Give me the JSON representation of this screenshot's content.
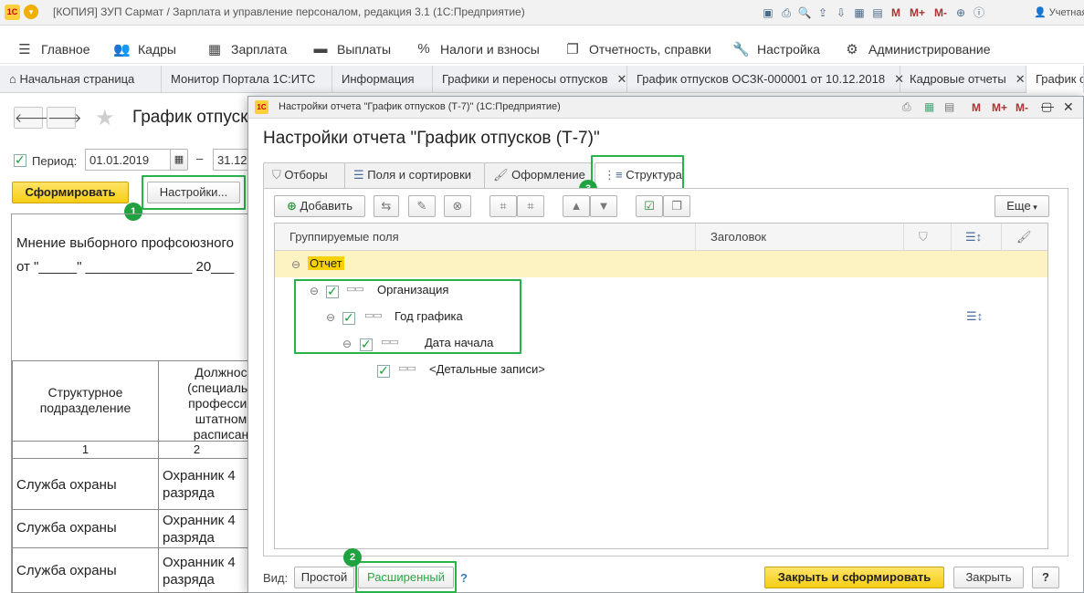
{
  "app": {
    "title": "[КОПИЯ] ЗУП Сармат / Зарплата и управление персоналом, редакция 3.1  (1С:Предприятие)",
    "logo": "1С",
    "user": "Учетная",
    "titlebar_icons": [
      "save-icon",
      "print-icon",
      "preview-icon",
      "upload-icon",
      "download-icon",
      "calculator-icon",
      "calendar-icon"
    ],
    "titlebar_m": [
      "M",
      "M+",
      "M-"
    ]
  },
  "main_menu": [
    {
      "label": "Главное",
      "icon": "menu-icon"
    },
    {
      "label": "Кадры",
      "icon": "people-icon"
    },
    {
      "label": "Зарплата",
      "icon": "calculator-icon"
    },
    {
      "label": "Выплаты",
      "icon": "wallet-icon"
    },
    {
      "label": "Налоги и взносы",
      "icon": "percent-icon"
    },
    {
      "label": "Отчетность, справки",
      "icon": "documents-icon"
    },
    {
      "label": "Настройка",
      "icon": "wrench-icon"
    },
    {
      "label": "Администрирование",
      "icon": "gear-icon"
    }
  ],
  "window_tabs": [
    {
      "label": "Начальная страница"
    },
    {
      "label": "Монитор Портала 1С:ИТС"
    },
    {
      "label": "Информация"
    },
    {
      "label": "Графики и переносы отпусков"
    },
    {
      "label": "График отпусков ОСЗК-000001 от 10.12.2018"
    },
    {
      "label": "Кадровые отчеты"
    },
    {
      "label": "График о"
    }
  ],
  "background": {
    "title": "График отпусков",
    "period_label": "Период:",
    "period_from": "01.01.2019",
    "period_dash": "–",
    "period_to": "31.12",
    "generate_button": "Сформировать",
    "settings_button": "Настройки...",
    "doc_line1": "Мнение выборного профсоюзного",
    "doc_line2": "от \"_____\" ______________ 20___",
    "table_headers": [
      "Структурное подразделение",
      "Должнос (специальн профессия штатном расписан"
    ],
    "column_numbers": [
      "1",
      "2"
    ],
    "rows": [
      {
        "dept": "Служба охраны",
        "position": "Охранник 4 разряда"
      },
      {
        "dept": "Служба охраны",
        "position": "Охранник 4 разряда"
      },
      {
        "dept": "Служба охраны",
        "position": "Охранник 4 разряда"
      }
    ]
  },
  "modal": {
    "window_title": "Настройки отчета \"График отпусков (Т-7)\"  (1С:Предприятие)",
    "heading": "Настройки отчета \"График отпусков (Т-7)\"",
    "tabs": [
      {
        "label": "Отборы",
        "icon": "filter-icon"
      },
      {
        "label": "Поля и сортировки",
        "icon": "sort-icon"
      },
      {
        "label": "Оформление",
        "icon": "brush-icon"
      },
      {
        "label": "Структура",
        "icon": "structure-icon"
      }
    ],
    "toolbar": {
      "add_label": "Добавить",
      "more_label": "Еще"
    },
    "grid": {
      "col_fields": "Группируемые поля",
      "col_header": "Заголовок",
      "rows": [
        {
          "label": "Отчет"
        },
        {
          "label": "Организация"
        },
        {
          "label": "Год графика"
        },
        {
          "label": "Дата начала"
        },
        {
          "label": "<Детальные записи>"
        }
      ]
    },
    "footer": {
      "view_label": "Вид:",
      "simple": "Простой",
      "extended": "Расширенный",
      "help": "?",
      "close_generate": "Закрыть и сформировать",
      "close": "Закрыть",
      "help_btn": "?"
    },
    "title_m": [
      "M",
      "M+",
      "M-"
    ]
  },
  "badges": [
    "1",
    "2",
    "3"
  ],
  "colors": {
    "highlight": "#27b34a",
    "accent_yellow": "#f6cd14",
    "selected_row": "#fdf2c2"
  }
}
